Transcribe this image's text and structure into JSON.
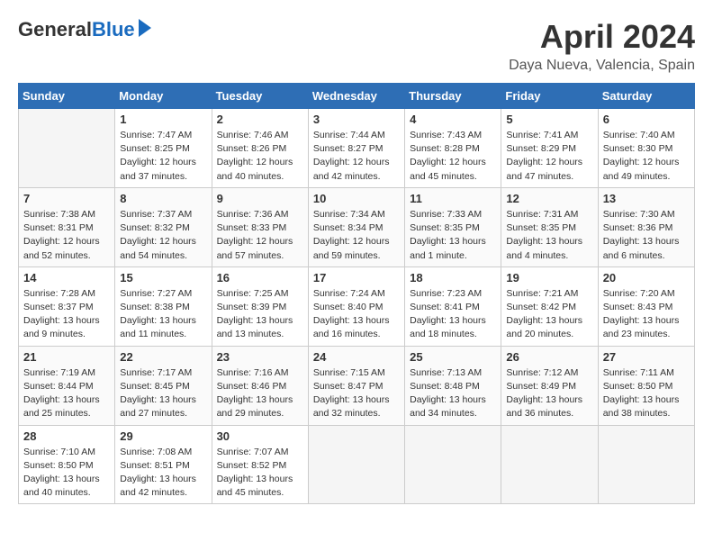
{
  "header": {
    "logo_general": "General",
    "logo_blue": "Blue",
    "month_title": "April 2024",
    "location": "Daya Nueva, Valencia, Spain"
  },
  "days_of_week": [
    "Sunday",
    "Monday",
    "Tuesday",
    "Wednesday",
    "Thursday",
    "Friday",
    "Saturday"
  ],
  "weeks": [
    [
      {
        "day": "",
        "empty": true
      },
      {
        "day": "1",
        "sunrise": "Sunrise: 7:47 AM",
        "sunset": "Sunset: 8:25 PM",
        "daylight": "Daylight: 12 hours and 37 minutes."
      },
      {
        "day": "2",
        "sunrise": "Sunrise: 7:46 AM",
        "sunset": "Sunset: 8:26 PM",
        "daylight": "Daylight: 12 hours and 40 minutes."
      },
      {
        "day": "3",
        "sunrise": "Sunrise: 7:44 AM",
        "sunset": "Sunset: 8:27 PM",
        "daylight": "Daylight: 12 hours and 42 minutes."
      },
      {
        "day": "4",
        "sunrise": "Sunrise: 7:43 AM",
        "sunset": "Sunset: 8:28 PM",
        "daylight": "Daylight: 12 hours and 45 minutes."
      },
      {
        "day": "5",
        "sunrise": "Sunrise: 7:41 AM",
        "sunset": "Sunset: 8:29 PM",
        "daylight": "Daylight: 12 hours and 47 minutes."
      },
      {
        "day": "6",
        "sunrise": "Sunrise: 7:40 AM",
        "sunset": "Sunset: 8:30 PM",
        "daylight": "Daylight: 12 hours and 49 minutes."
      }
    ],
    [
      {
        "day": "7",
        "sunrise": "Sunrise: 7:38 AM",
        "sunset": "Sunset: 8:31 PM",
        "daylight": "Daylight: 12 hours and 52 minutes."
      },
      {
        "day": "8",
        "sunrise": "Sunrise: 7:37 AM",
        "sunset": "Sunset: 8:32 PM",
        "daylight": "Daylight: 12 hours and 54 minutes."
      },
      {
        "day": "9",
        "sunrise": "Sunrise: 7:36 AM",
        "sunset": "Sunset: 8:33 PM",
        "daylight": "Daylight: 12 hours and 57 minutes."
      },
      {
        "day": "10",
        "sunrise": "Sunrise: 7:34 AM",
        "sunset": "Sunset: 8:34 PM",
        "daylight": "Daylight: 12 hours and 59 minutes."
      },
      {
        "day": "11",
        "sunrise": "Sunrise: 7:33 AM",
        "sunset": "Sunset: 8:35 PM",
        "daylight": "Daylight: 13 hours and 1 minute."
      },
      {
        "day": "12",
        "sunrise": "Sunrise: 7:31 AM",
        "sunset": "Sunset: 8:35 PM",
        "daylight": "Daylight: 13 hours and 4 minutes."
      },
      {
        "day": "13",
        "sunrise": "Sunrise: 7:30 AM",
        "sunset": "Sunset: 8:36 PM",
        "daylight": "Daylight: 13 hours and 6 minutes."
      }
    ],
    [
      {
        "day": "14",
        "sunrise": "Sunrise: 7:28 AM",
        "sunset": "Sunset: 8:37 PM",
        "daylight": "Daylight: 13 hours and 9 minutes."
      },
      {
        "day": "15",
        "sunrise": "Sunrise: 7:27 AM",
        "sunset": "Sunset: 8:38 PM",
        "daylight": "Daylight: 13 hours and 11 minutes."
      },
      {
        "day": "16",
        "sunrise": "Sunrise: 7:25 AM",
        "sunset": "Sunset: 8:39 PM",
        "daylight": "Daylight: 13 hours and 13 minutes."
      },
      {
        "day": "17",
        "sunrise": "Sunrise: 7:24 AM",
        "sunset": "Sunset: 8:40 PM",
        "daylight": "Daylight: 13 hours and 16 minutes."
      },
      {
        "day": "18",
        "sunrise": "Sunrise: 7:23 AM",
        "sunset": "Sunset: 8:41 PM",
        "daylight": "Daylight: 13 hours and 18 minutes."
      },
      {
        "day": "19",
        "sunrise": "Sunrise: 7:21 AM",
        "sunset": "Sunset: 8:42 PM",
        "daylight": "Daylight: 13 hours and 20 minutes."
      },
      {
        "day": "20",
        "sunrise": "Sunrise: 7:20 AM",
        "sunset": "Sunset: 8:43 PM",
        "daylight": "Daylight: 13 hours and 23 minutes."
      }
    ],
    [
      {
        "day": "21",
        "sunrise": "Sunrise: 7:19 AM",
        "sunset": "Sunset: 8:44 PM",
        "daylight": "Daylight: 13 hours and 25 minutes."
      },
      {
        "day": "22",
        "sunrise": "Sunrise: 7:17 AM",
        "sunset": "Sunset: 8:45 PM",
        "daylight": "Daylight: 13 hours and 27 minutes."
      },
      {
        "day": "23",
        "sunrise": "Sunrise: 7:16 AM",
        "sunset": "Sunset: 8:46 PM",
        "daylight": "Daylight: 13 hours and 29 minutes."
      },
      {
        "day": "24",
        "sunrise": "Sunrise: 7:15 AM",
        "sunset": "Sunset: 8:47 PM",
        "daylight": "Daylight: 13 hours and 32 minutes."
      },
      {
        "day": "25",
        "sunrise": "Sunrise: 7:13 AM",
        "sunset": "Sunset: 8:48 PM",
        "daylight": "Daylight: 13 hours and 34 minutes."
      },
      {
        "day": "26",
        "sunrise": "Sunrise: 7:12 AM",
        "sunset": "Sunset: 8:49 PM",
        "daylight": "Daylight: 13 hours and 36 minutes."
      },
      {
        "day": "27",
        "sunrise": "Sunrise: 7:11 AM",
        "sunset": "Sunset: 8:50 PM",
        "daylight": "Daylight: 13 hours and 38 minutes."
      }
    ],
    [
      {
        "day": "28",
        "sunrise": "Sunrise: 7:10 AM",
        "sunset": "Sunset: 8:50 PM",
        "daylight": "Daylight: 13 hours and 40 minutes."
      },
      {
        "day": "29",
        "sunrise": "Sunrise: 7:08 AM",
        "sunset": "Sunset: 8:51 PM",
        "daylight": "Daylight: 13 hours and 42 minutes."
      },
      {
        "day": "30",
        "sunrise": "Sunrise: 7:07 AM",
        "sunset": "Sunset: 8:52 PM",
        "daylight": "Daylight: 13 hours and 45 minutes."
      },
      {
        "day": "",
        "empty": true
      },
      {
        "day": "",
        "empty": true
      },
      {
        "day": "",
        "empty": true
      },
      {
        "day": "",
        "empty": true
      }
    ]
  ]
}
